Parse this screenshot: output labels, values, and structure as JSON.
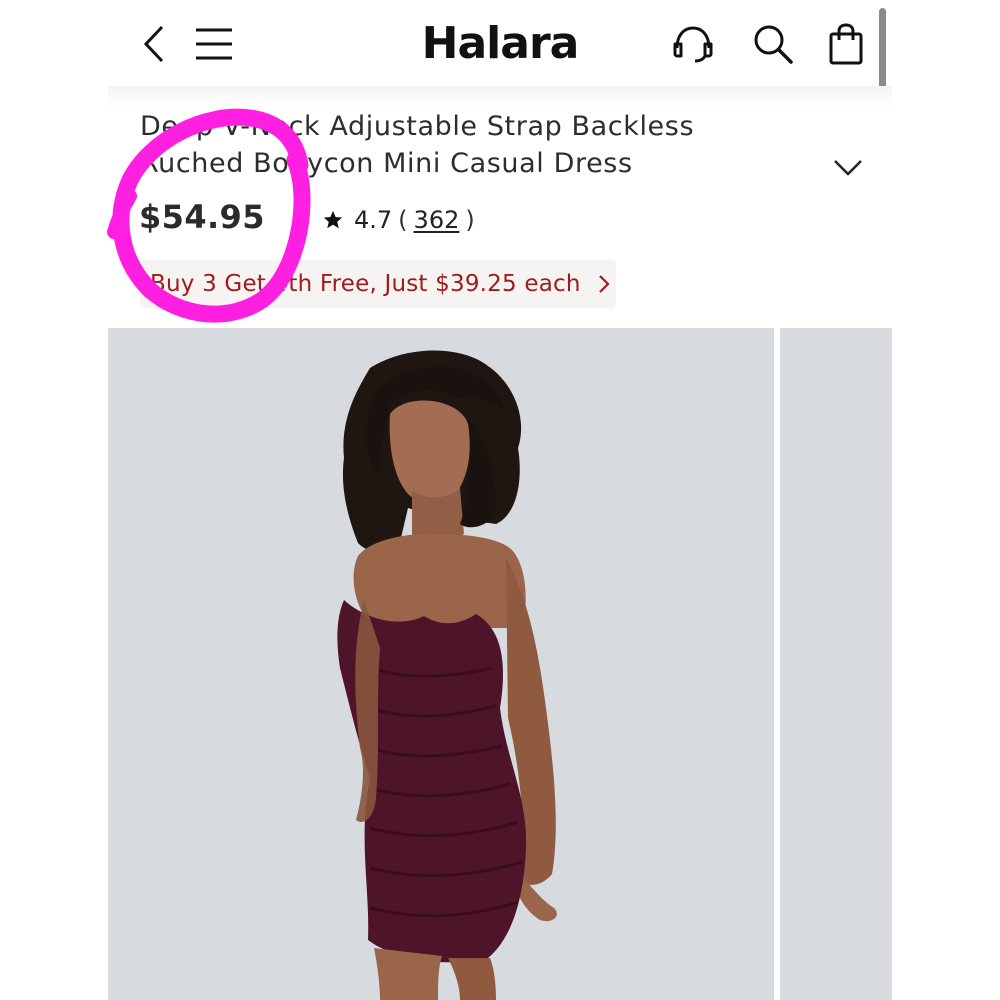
{
  "header": {
    "logo": "Halara",
    "icons": [
      "back-arrow-icon",
      "menu-icon",
      "customer-support-icon",
      "search-icon",
      "shopping-bag-icon"
    ]
  },
  "product": {
    "title_line1": "Deep V-Neck Adjustable Strap Backless",
    "title_line2": "Ruched Bodycon Mini Casual Dress",
    "price": "$54.95",
    "rating": "4.7",
    "paren_open": "(",
    "review_count": "362",
    "paren_close": ")",
    "promo": "Buy 3 Get 4th Free, Just $39.25 each"
  },
  "gallery": {
    "image_subject": "model wearing plum ruched bodycon mini dress",
    "background_color": "#d7dbe0",
    "dress_color": "#4e1429"
  },
  "colors": {
    "promo_text": "#a01c1c",
    "annotation_marker": "#ff1fe0"
  }
}
